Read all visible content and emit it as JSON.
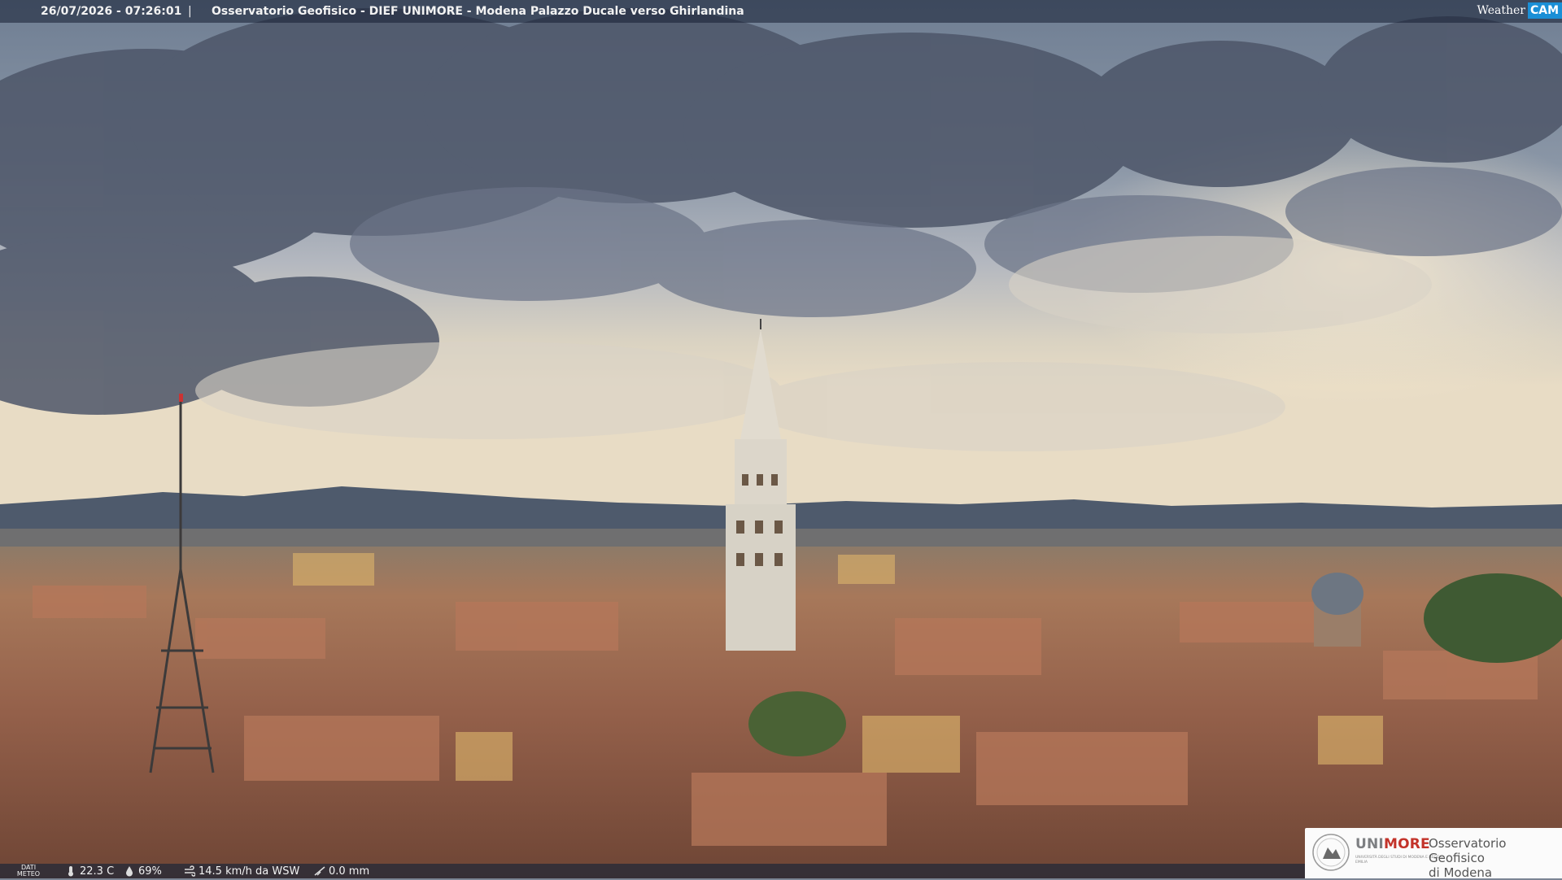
{
  "header": {
    "timestamp": "26/07/2026 - 07:26:01",
    "separator": "|",
    "title": "Osservatorio Geofisico - DIEF UNIMORE - Modena Palazzo Ducale verso Ghirlandina"
  },
  "brand": {
    "weather": "Weather",
    "cam": "CAM"
  },
  "weather_bar": {
    "label_line1": "DATI",
    "label_line2": "METEO",
    "temperature": "22.3 C",
    "humidity": "69%",
    "wind": "14.5 km/h da WSW",
    "rain": "0.0 mm"
  },
  "logo": {
    "university": "UNI",
    "university_accent": "MORE",
    "university_sub": "UNIVERSITÀ DEGLI STUDI DI MODENA E REGGIO EMILIA",
    "observatory_line1": "Osservatorio Geofisico",
    "observatory_line2": "di Modena"
  },
  "icons": [
    "thermometer-icon",
    "humidity-drop-icon",
    "wind-icon",
    "rain-icon",
    "university-seal-icon"
  ],
  "colors": {
    "accent_blue": "#1a8fd6",
    "unimore_red": "#c3332a"
  }
}
